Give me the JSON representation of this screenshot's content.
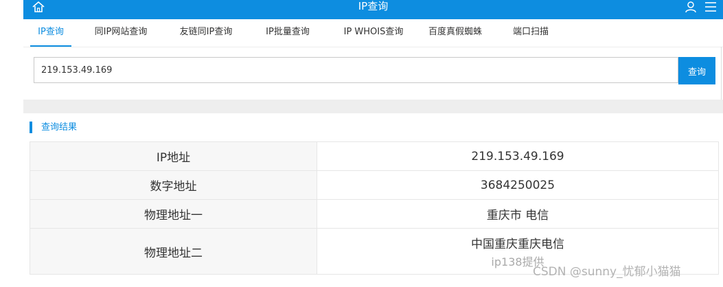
{
  "header": {
    "title": "IP查询",
    "icons": [
      "home-icon",
      "user-icon",
      "menu-icon"
    ]
  },
  "tabs": [
    {
      "label": "IP查询",
      "active": true
    },
    {
      "label": "同IP网站查询"
    },
    {
      "label": "友链同IP查询"
    },
    {
      "label": "IP批量查询"
    },
    {
      "label": "IP WHOIS查询"
    },
    {
      "label": "百度真假蜘蛛"
    },
    {
      "label": "端口扫描"
    }
  ],
  "search": {
    "value": "219.153.49.169",
    "button_label": "查询"
  },
  "results": {
    "title": "查询结果",
    "rows": [
      {
        "label": "IP地址",
        "value": "219.153.49.169"
      },
      {
        "label": "数字地址",
        "value": "3684250025"
      },
      {
        "label": "物理地址一",
        "value": "重庆市 电信"
      },
      {
        "label": "物理地址二",
        "value": "中国重庆重庆电信",
        "provider": "ip138提供"
      }
    ]
  },
  "watermark": "CSDN @sunny_忧郁小猫猫",
  "colors": {
    "accent": "#0d8de0",
    "label_bg": "#f7f7f7",
    "border": "#e6e6e6"
  }
}
